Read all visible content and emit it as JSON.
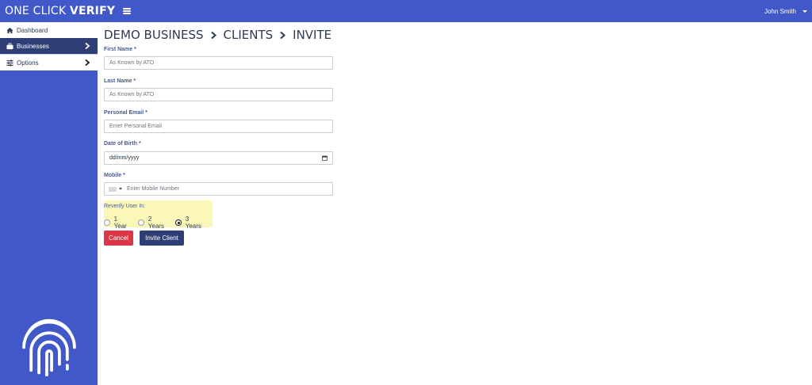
{
  "app": {
    "brand_light": "ONE CLICK ",
    "brand_bold": "VERIFY",
    "user_name": "John Smith"
  },
  "sidebar": {
    "items": [
      {
        "label": "Dashboard",
        "icon": "home-icon"
      },
      {
        "label": "Businesses",
        "icon": "briefcase-icon"
      },
      {
        "label": "Options",
        "icon": "sliders-icon"
      }
    ],
    "logo_icon": "fingerprint-icon"
  },
  "breadcrumb": [
    "DEMO BUSINESS",
    "CLIENTS",
    "INVITE"
  ],
  "form": {
    "first_name": {
      "label": "First Name *",
      "placeholder": "As Known by ATO"
    },
    "last_name": {
      "label": "Last Name *",
      "placeholder": "As Known by ATO"
    },
    "email": {
      "label": "Personal Email *",
      "placeholder": "Enter Personal Email"
    },
    "dob": {
      "label": "Date of Birth *",
      "value": "dd/mm/yyyy"
    },
    "mobile": {
      "label": "Mobile *",
      "placeholder": "Enter Mobile Number"
    },
    "reverify": {
      "label": "Reverify User In:",
      "options": [
        "1 Year",
        "2 Years",
        "3 Years"
      ],
      "selected": "3 Years"
    },
    "cancel_label": "Cancel",
    "submit_label": "Invite Client"
  },
  "colors": {
    "primary": "#4158c9",
    "navy": "#2f3f75",
    "danger": "#dc3545",
    "highlight": "#fbf7b8"
  }
}
